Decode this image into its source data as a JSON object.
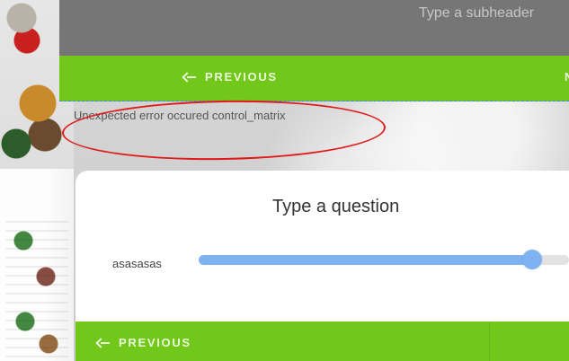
{
  "header": {
    "subheader_placeholder": "Type a subheader"
  },
  "top_nav": {
    "previous_label": "PREVIOUS",
    "next_partial_label": "N"
  },
  "error": {
    "message": "Unexpected error occured control_matrix"
  },
  "question": {
    "title": "Type a question",
    "row_label": "asasasas",
    "slider": {
      "value_fraction": 0.9
    }
  },
  "bottom_nav": {
    "previous_label": "PREVIOUS"
  },
  "colors": {
    "green": "#72c81a",
    "slider_blue": "#7fb2f0",
    "error_red": "#e01b1b"
  }
}
